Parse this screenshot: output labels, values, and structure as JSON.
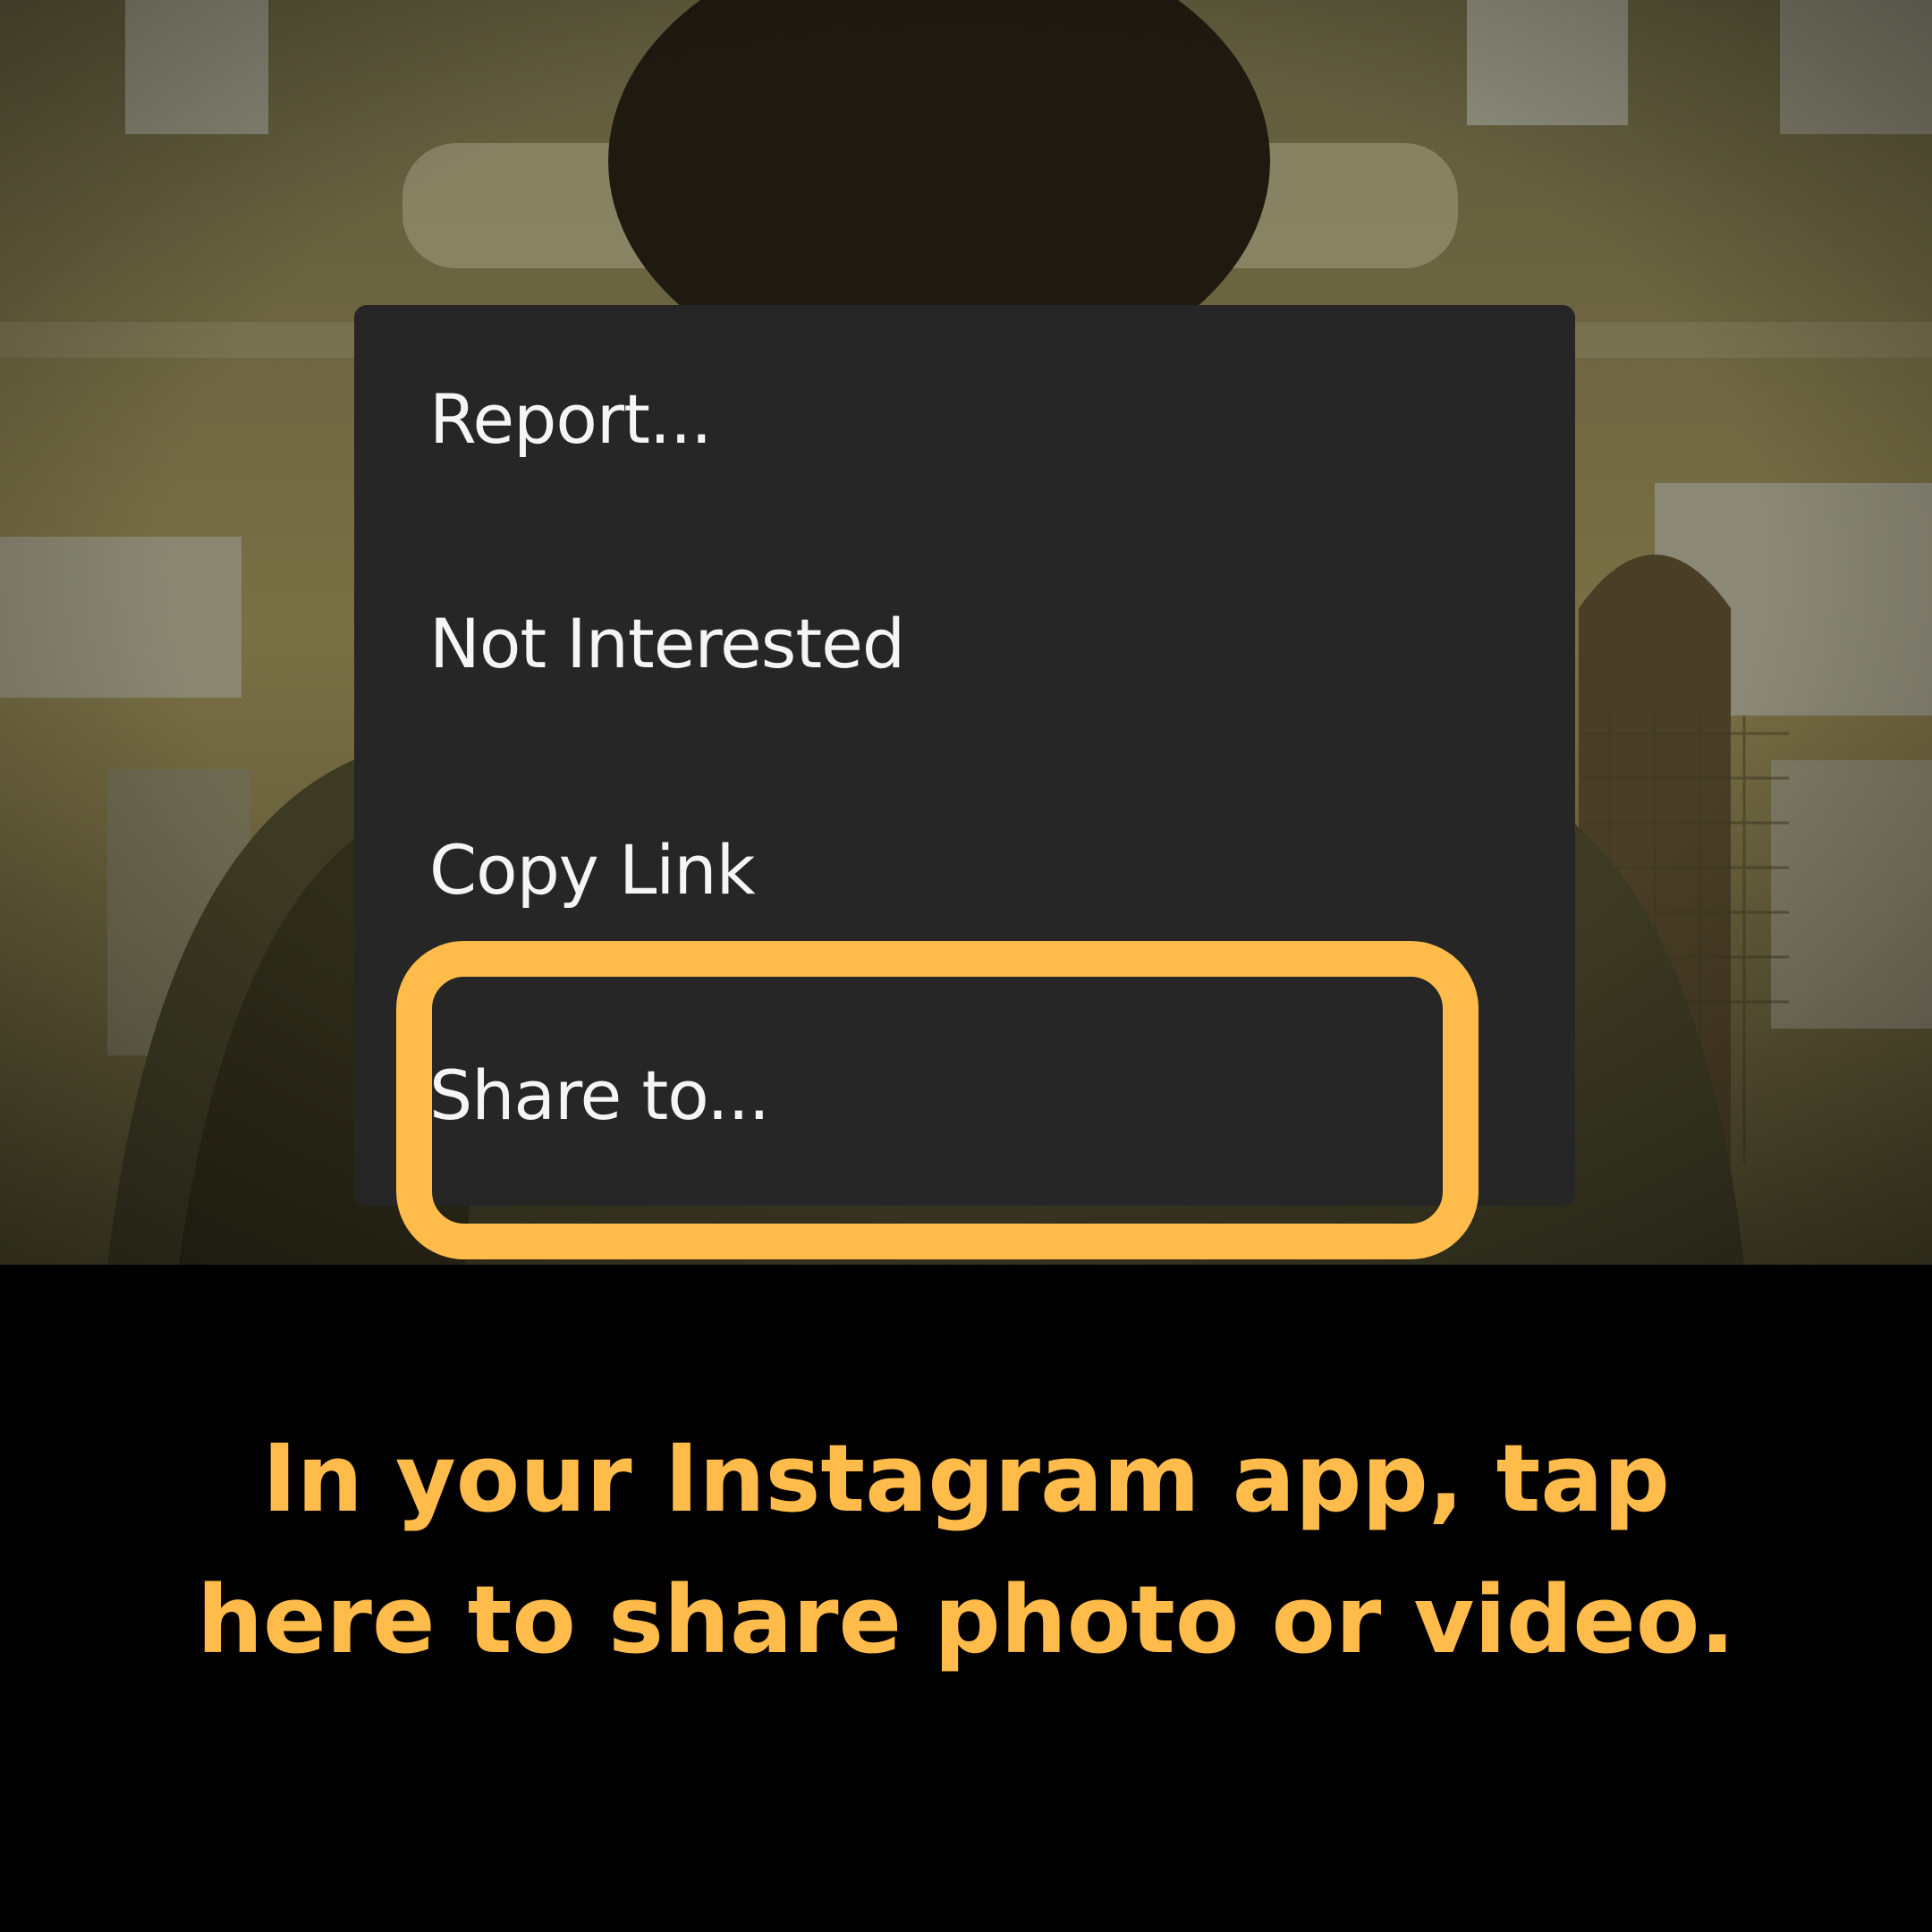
{
  "menu": {
    "items": [
      {
        "label": "Report..."
      },
      {
        "label": "Not Interested"
      },
      {
        "label": "Copy Link"
      },
      {
        "label": "Share to..."
      }
    ]
  },
  "caption": {
    "line1": "In your Instagram app, tap",
    "line2": "here to share photo or video."
  },
  "colors": {
    "accent": "#ffbc4b",
    "menu_background": "#262626",
    "menu_text": "#f5f5f5",
    "caption_panel": "#000000"
  }
}
